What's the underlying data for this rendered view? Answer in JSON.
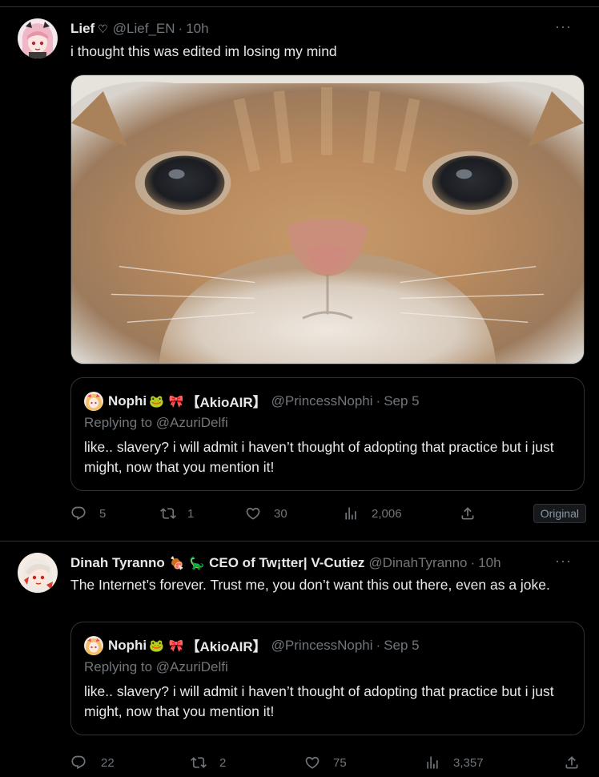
{
  "tweets": [
    {
      "author": {
        "name": "Lief",
        "name_suffix": "♡",
        "handle": "@Lief_EN"
      },
      "time": "10h",
      "text": "i thought this was edited im losing my mind",
      "more_label": "···",
      "quote": {
        "author": {
          "name": "Nophi",
          "emoji1": "🐸",
          "emoji2": "🎀",
          "name_suffix": "【AkioAIR】",
          "handle": "@PrincessNophi"
        },
        "time": "Sep 5",
        "replying_prefix": "Replying to ",
        "replying_to": "@AzuriDelfi",
        "text": "like.. slavery? i will admit i haven’t thought of adopting that practice but i just might, now that you mention it!"
      },
      "actions": {
        "replies": "5",
        "reposts": "1",
        "likes": "30",
        "views": "2,006"
      },
      "badge": "Original"
    },
    {
      "author": {
        "name": "Dinah Tyranno",
        "emoji1": "🍖",
        "emoji2": "🦕",
        "name_suffix": "CEO of Tw¡tter| V-Cutiez",
        "handle": "@DinahTyranno"
      },
      "time": "10h",
      "text": "The Internet’s forever. Trust me, you don’t want this out there, even as a joke.",
      "more_label": "···",
      "quote": {
        "author": {
          "name": "Nophi",
          "emoji1": "🐸",
          "emoji2": "🎀",
          "name_suffix": "【AkioAIR】",
          "handle": "@PrincessNophi"
        },
        "time": "Sep 5",
        "replying_prefix": "Replying to ",
        "replying_to": "@AzuriDelfi",
        "text": "like.. slavery? i will admit i haven’t thought of adopting that practice but i just might, now that you mention it!"
      },
      "actions": {
        "replies": "22",
        "reposts": "2",
        "likes": "75",
        "views": "3,357"
      }
    }
  ],
  "icons": {
    "reply": "reply-icon",
    "repost": "repost-icon",
    "like": "like-icon",
    "views": "views-icon",
    "share": "share-icon"
  }
}
